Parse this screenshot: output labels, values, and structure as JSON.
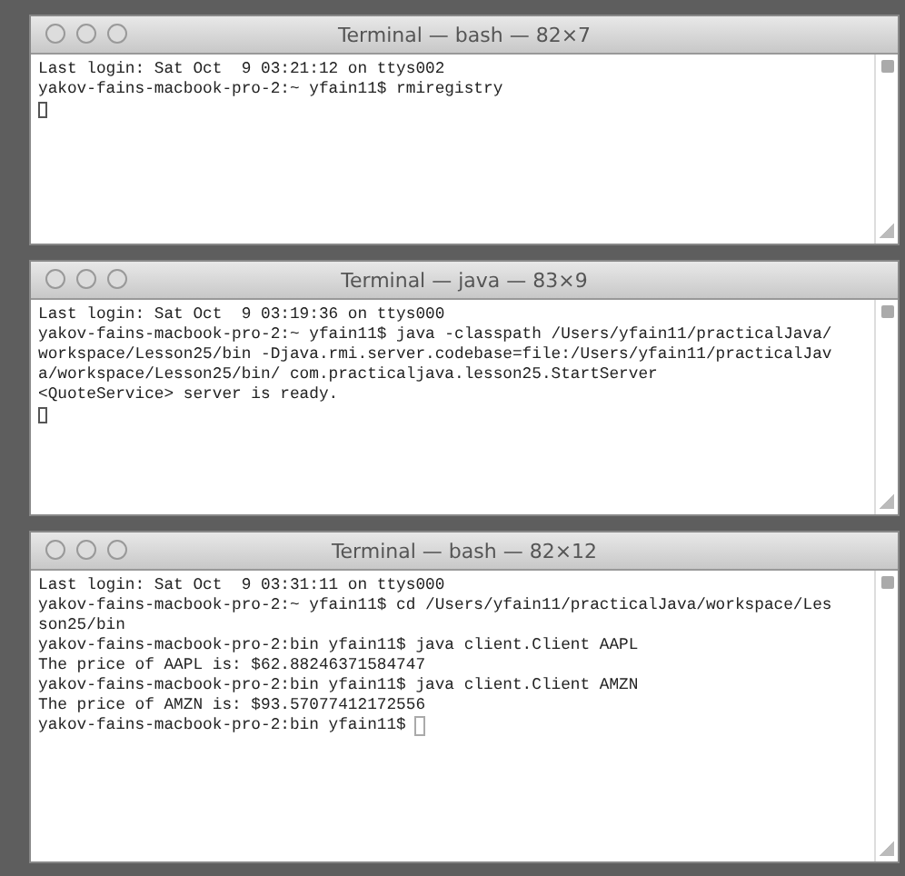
{
  "windows": [
    {
      "title": "Terminal — bash — 82×7",
      "cursor_on_new_line": true,
      "lines": [
        "Last login: Sat Oct  9 03:21:12 on ttys002",
        "yakov-fains-macbook-pro-2:~ yfain11$ rmiregistry"
      ]
    },
    {
      "title": "Terminal — java — 83×9",
      "cursor_on_new_line": true,
      "lines": [
        "Last login: Sat Oct  9 03:19:36 on ttys000",
        "yakov-fains-macbook-pro-2:~ yfain11$ java -classpath /Users/yfain11/practicalJava/",
        "workspace/Lesson25/bin -Djava.rmi.server.codebase=file:/Users/yfain11/practicalJav",
        "a/workspace/Lesson25/bin/ com.practicaljava.lesson25.StartServer",
        "<QuoteService> server is ready."
      ]
    },
    {
      "title": "Terminal — bash — 82×12",
      "cursor_on_new_line": false,
      "lines": [
        "Last login: Sat Oct  9 03:31:11 on ttys000",
        "yakov-fains-macbook-pro-2:~ yfain11$ cd /Users/yfain11/practicalJava/workspace/Les",
        "son25/bin",
        "yakov-fains-macbook-pro-2:bin yfain11$ java client.Client AAPL",
        "The price of AAPL is: $62.88246371584747",
        "yakov-fains-macbook-pro-2:bin yfain11$ java client.Client AMZN",
        "The price of AMZN is: $93.57077412172556",
        "yakov-fains-macbook-pro-2:bin yfain11$"
      ]
    }
  ]
}
